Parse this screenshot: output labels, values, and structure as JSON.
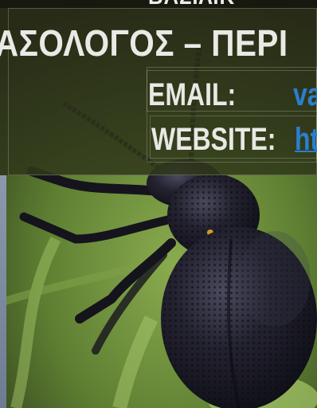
{
  "header": {
    "headline_partial": "ΒΑΣΙΛΙΚ",
    "title": "ΑΣΟΛΟΓΟΣ – ΠΕΡΙ"
  },
  "contact": {
    "email_label": "EMAIL:",
    "email_value": "va",
    "website_label": "WEBSITE:",
    "website_value": "ht"
  },
  "colors": {
    "text_light": "#e8e8e4",
    "link_blue": "#2a7fd0",
    "overlay": "#2c3018",
    "beetle": "#1e1d2a",
    "foliage": "#6f8f3e"
  }
}
